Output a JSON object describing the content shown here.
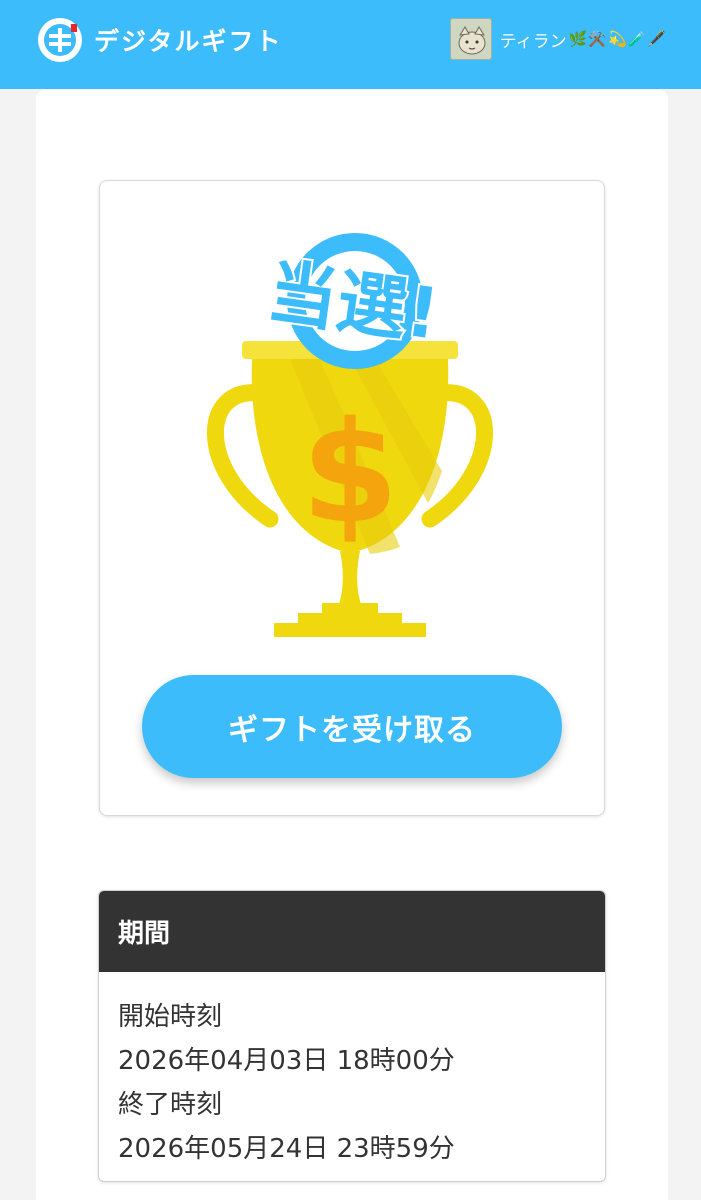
{
  "header": {
    "brand": "デジタルギフト",
    "user_name": "ティラン",
    "user_emoji": "🌿⚒️💫🧪🖋️"
  },
  "prize": {
    "badge_text": "当選!",
    "receive_button": "ギフトを受け取る"
  },
  "period": {
    "title": "期間",
    "start_label": "開始時刻",
    "start_value": "2026年04月03日 18時00分",
    "end_label": "終了時刻",
    "end_value": "2026年05月24日 23時59分"
  },
  "colors": {
    "accent": "#3cbcfb",
    "trophy": "#f0d80f",
    "dollar": "#f4a40c",
    "period_header": "#333333"
  }
}
